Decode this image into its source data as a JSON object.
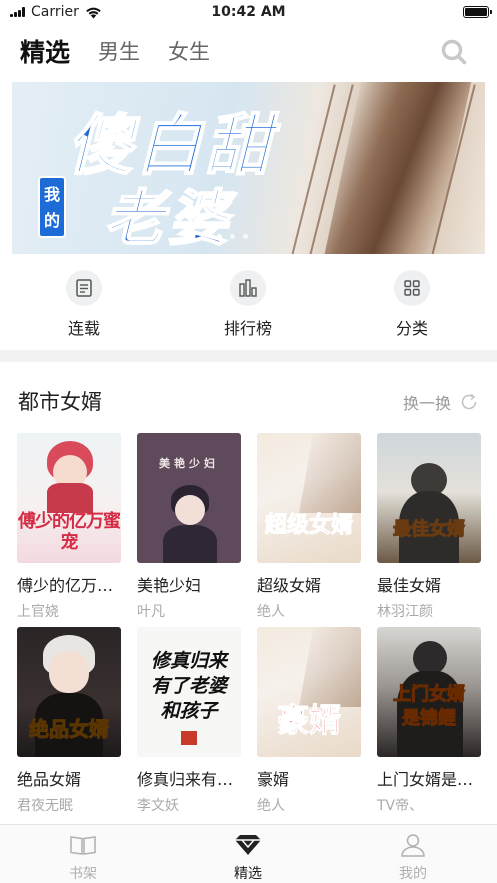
{
  "status_bar": {
    "carrier": "Carrier",
    "time": "10:42 AM"
  },
  "top_nav": {
    "tabs": [
      "精选",
      "男生",
      "女生"
    ],
    "active_tab": "精选"
  },
  "banner": {
    "title_line1": "傻白甜",
    "title_line2": "老婆",
    "tag": "我的",
    "page_count": 3,
    "current_page": 1
  },
  "quick_links": [
    {
      "label": "连载",
      "icon": "book-list-icon"
    },
    {
      "label": "排行榜",
      "icon": "bar-chart-icon"
    },
    {
      "label": "分类",
      "icon": "grid-icon"
    }
  ],
  "section": {
    "title": "都市女婿",
    "refresh_label": "换一换"
  },
  "books": [
    {
      "title": "傅少的亿万蜜宠",
      "author": "上官娆",
      "cover_text": "傅少的亿万蜜宠"
    },
    {
      "title": "美艳少妇",
      "author": "叶凡",
      "cover_text": "美艳少妇"
    },
    {
      "title": "超级女婿",
      "author": "绝人",
      "cover_text": "超级女婿"
    },
    {
      "title": "最佳女婿",
      "author": "林羽江颜",
      "cover_text": "最佳女婿"
    },
    {
      "title": "绝品女婿",
      "author": "君夜无眠",
      "cover_text": "绝品女婿"
    },
    {
      "title": "修真归来有老婆和孩子",
      "author": "李文妖",
      "cover_text": "修真归来有了老婆和孩子"
    },
    {
      "title": "豪婿",
      "author": "绝人",
      "cover_text": "豪婿"
    },
    {
      "title": "上门女婿是锦鲤",
      "author": "TV帝、",
      "cover_text": "上门女婿是锦鲤"
    }
  ],
  "tab_bar": {
    "items": [
      {
        "label": "书架",
        "icon": "bookshelf-icon"
      },
      {
        "label": "精选",
        "icon": "diamond-icon"
      },
      {
        "label": "我的",
        "icon": "profile-icon"
      }
    ],
    "active": "精选"
  },
  "colors": {
    "banner_blue": "#1c6bd6",
    "muted_text": "#aaaaaa",
    "active_text": "#222222"
  }
}
